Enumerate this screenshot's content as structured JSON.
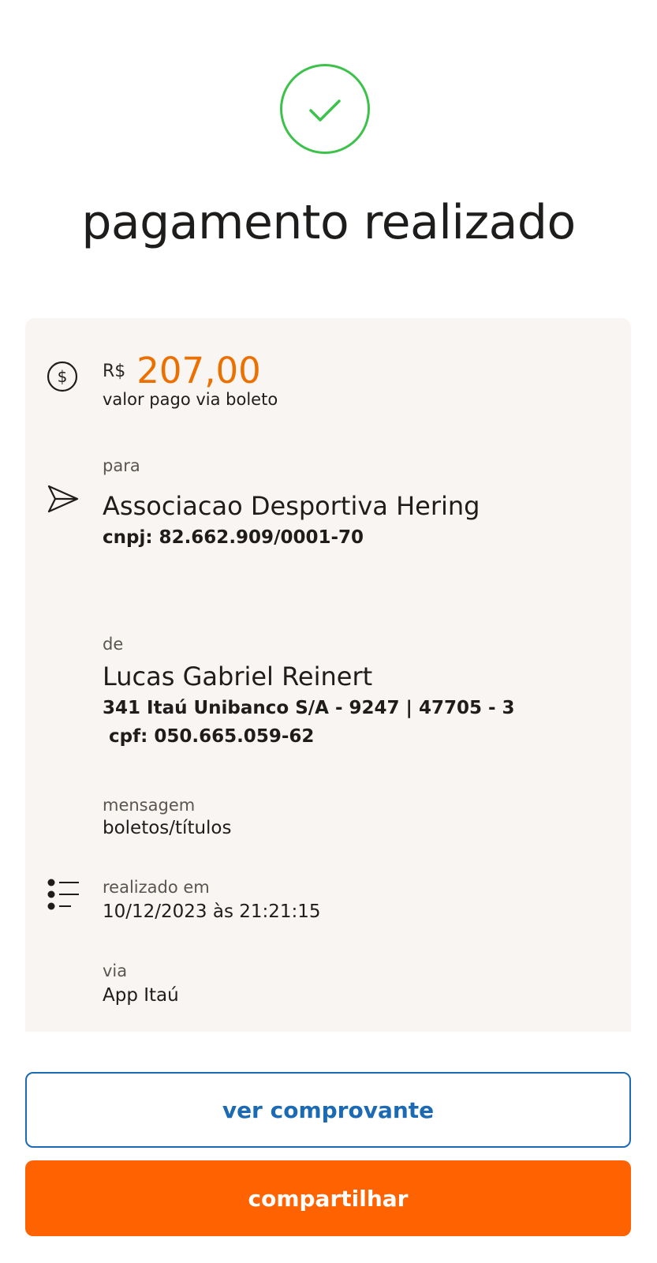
{
  "header": {
    "title": "pagamento realizado",
    "status_color": "#3cc24a",
    "status_icon": "check-icon"
  },
  "payment": {
    "currency": "R$",
    "amount": "207,00",
    "amount_caption": "valor pago via boleto",
    "accent_color": "#ec7000"
  },
  "recipient": {
    "label": "para",
    "name": "Associacao Desportiva Hering",
    "document": "cnpj: 82.662.909/0001-70"
  },
  "payer": {
    "label": "de",
    "name": "Lucas Gabriel Reinert",
    "bank_info": "341 Itaú Unibanco S/A - 9247 | 47705 - 3",
    "document": " cpf: 050.665.059-62"
  },
  "message": {
    "label": "mensagem",
    "value": "boletos/títulos"
  },
  "date": {
    "label": "realizado em",
    "value": "10/12/2023 às 21:21:15"
  },
  "channel": {
    "label": "via",
    "value": "App Itaú"
  },
  "actions": {
    "view_receipt": "ver comprovante",
    "share": "compartilhar",
    "view_receipt_color": "#1d6ab4",
    "share_color": "#ff6200"
  }
}
